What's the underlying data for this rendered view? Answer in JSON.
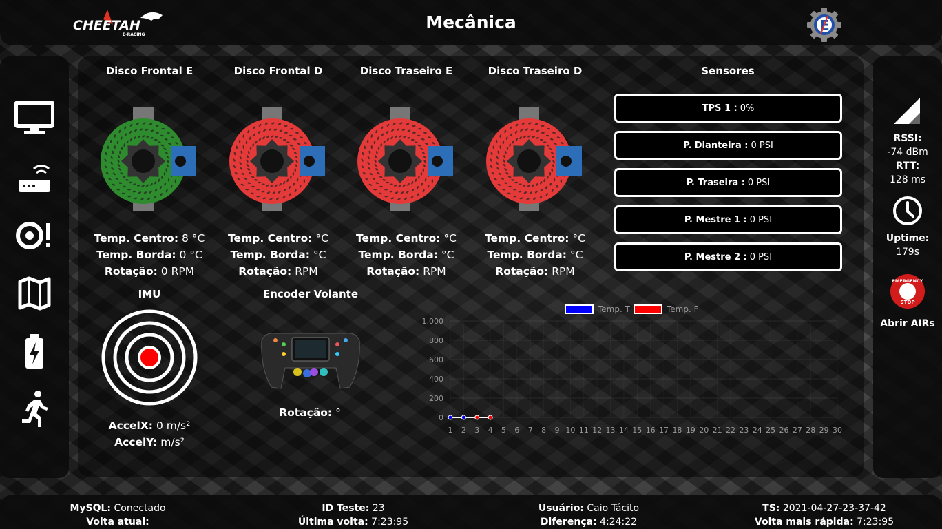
{
  "header": {
    "title": "Mecânica",
    "logo_text": "CHEETAH",
    "logo_sub": "E-RACING"
  },
  "nav": {
    "items": [
      {
        "name": "monitor-icon"
      },
      {
        "name": "router-icon"
      },
      {
        "name": "tire-alert-icon"
      },
      {
        "name": "map-icon"
      },
      {
        "name": "battery-icon"
      },
      {
        "name": "running-person-icon"
      }
    ]
  },
  "discs": [
    {
      "title": "Disco Frontal E",
      "color": "#2e8b2e",
      "temp_centro_label": "Temp. Centro:",
      "temp_centro": "8 °C",
      "temp_borda_label": "Temp. Borda:",
      "temp_borda": "0 °C",
      "rotacao_label": "Rotação:",
      "rotacao": "0 RPM"
    },
    {
      "title": "Disco Frontal D",
      "color": "#e43a3a",
      "temp_centro_label": "Temp. Centro:",
      "temp_centro": "°C",
      "temp_borda_label": "Temp. Borda:",
      "temp_borda": "°C",
      "rotacao_label": "Rotação:",
      "rotacao": "RPM"
    },
    {
      "title": "Disco Traseiro E",
      "color": "#e43a3a",
      "temp_centro_label": "Temp. Centro:",
      "temp_centro": "°C",
      "temp_borda_label": "Temp. Borda:",
      "temp_borda": "°C",
      "rotacao_label": "Rotação:",
      "rotacao": "RPM"
    },
    {
      "title": "Disco Traseiro D",
      "color": "#e43a3a",
      "temp_centro_label": "Temp. Centro:",
      "temp_centro": "°C",
      "temp_borda_label": "Temp. Borda:",
      "temp_borda": "°C",
      "rotacao_label": "Rotação:",
      "rotacao": "RPM"
    }
  ],
  "sensors": {
    "title": "Sensores",
    "items": [
      {
        "label": "TPS 1 :",
        "value": "0%"
      },
      {
        "label": "P. Dianteira :",
        "value": "0 PSI"
      },
      {
        "label": "P. Traseira :",
        "value": "0 PSI"
      },
      {
        "label": "P. Mestre 1 :",
        "value": "0 PSI"
      },
      {
        "label": "P. Mestre 2 :",
        "value": "0 PSI"
      }
    ]
  },
  "imu": {
    "title": "IMU",
    "accelx_label": "AccelX:",
    "accelx": "0 m/s²",
    "accely_label": "AccelY:",
    "accely": "m/s²"
  },
  "encoder": {
    "title": "Encoder Volante",
    "rotacao_label": "Rotação:",
    "rotacao": "°"
  },
  "chart_data": {
    "type": "line",
    "x": [
      1,
      2,
      3,
      4,
      5,
      6,
      7,
      8,
      9,
      10,
      11,
      12,
      13,
      14,
      15,
      16,
      17,
      18,
      19,
      20,
      21,
      22,
      23,
      24,
      25,
      26,
      27,
      28,
      29,
      30
    ],
    "ylim": [
      0,
      1000
    ],
    "yticks": [
      "0",
      "200",
      "400",
      "600",
      "800",
      "1,000"
    ],
    "series": [
      {
        "name": "Temp. T",
        "color": "#0000ff",
        "x": [
          1,
          2
        ],
        "values": [
          0,
          0
        ]
      },
      {
        "name": "Temp. F",
        "color": "#ff0000",
        "x": [
          3,
          4
        ],
        "values": [
          0,
          0
        ]
      }
    ],
    "legend": "top",
    "grid": true
  },
  "right": {
    "rssi_label": "RSSI:",
    "rssi": "-74 dBm",
    "rtt_label": "RTT:",
    "rtt": "128 ms",
    "uptime_label": "Uptime:",
    "uptime": "179s",
    "estop_top": "EMERGENCY",
    "estop_bottom": "STOP",
    "airs_label": "Abrir AIRs"
  },
  "footer": {
    "mysql_label": "MySQL:",
    "mysql": "Conectado",
    "volta_label": "Volta atual:",
    "volta": "",
    "id_label": "ID Teste:",
    "id": "23",
    "ultima_label": "Última volta:",
    "ultima": "7:23:95",
    "usuario_label": "Usuário:",
    "usuario": "Caio Tácito",
    "diferenca_label": "Diferença:",
    "diferenca": "4:24:22",
    "ts_label": "TS:",
    "ts": "2021-04-27-23-37-42",
    "rapida_label": "Volta mais rápida:",
    "rapida": "7:23:95"
  }
}
